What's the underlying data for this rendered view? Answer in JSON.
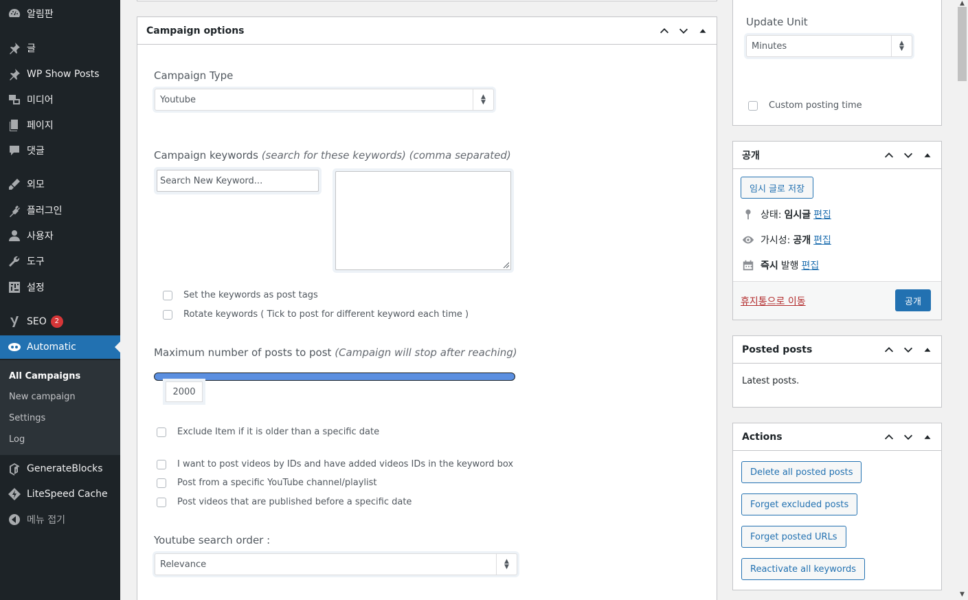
{
  "sidebar": {
    "items": [
      {
        "label": "알림판",
        "icon": "dashboard-icon"
      },
      {
        "label": "글",
        "icon": "pin-icon"
      },
      {
        "label": "WP Show Posts",
        "icon": "pin-icon"
      },
      {
        "label": "미디어",
        "icon": "media-icon"
      },
      {
        "label": "페이지",
        "icon": "page-icon"
      },
      {
        "label": "댓글",
        "icon": "comment-icon"
      },
      {
        "label": "외모",
        "icon": "brush-icon"
      },
      {
        "label": "플러그인",
        "icon": "plugin-icon"
      },
      {
        "label": "사용자",
        "icon": "user-icon"
      },
      {
        "label": "도구",
        "icon": "wrench-icon"
      },
      {
        "label": "설정",
        "icon": "settings-icon"
      },
      {
        "label": "SEO",
        "icon": "yoast-icon",
        "badge": "2"
      },
      {
        "label": "Automatic",
        "icon": "automatic-icon",
        "active": true
      },
      {
        "label": "GenerateBlocks",
        "icon": "generateblocks-icon"
      },
      {
        "label": "LiteSpeed Cache",
        "icon": "litespeed-icon"
      },
      {
        "label": "메뉴 접기",
        "icon": "collapse-icon"
      }
    ],
    "submenu": [
      "All Campaigns",
      "New campaign",
      "Settings",
      "Log"
    ]
  },
  "campaign_options": {
    "title": "Campaign options",
    "campaign_type_label": "Campaign Type",
    "campaign_type_value": "Youtube",
    "keywords_label": "Campaign keywords",
    "keywords_hint": "(search for these keywords) (comma separated)",
    "keyword_search_placeholder": "Search New Keyword...",
    "cb_tags": "Set the keywords as post tags",
    "cb_rotate": "Rotate keywords ( Tick to post for different keyword each time )",
    "max_posts_label": "Maximum number of posts to post",
    "max_posts_hint": "(Campaign will stop after reaching)",
    "max_posts_value": "2000",
    "cb_exclude_old": "Exclude Item if it is older than a specific date",
    "cb_video_ids": "I want to post videos by IDs and have added videos IDs in the keyword box",
    "cb_channel": "Post from a specific YouTube channel/playlist",
    "cb_before_date": "Post videos that are published before a specific date",
    "search_order_label": "Youtube search order :",
    "search_order_value": "Relevance"
  },
  "update_box": {
    "update_unit_label": "Update Unit",
    "update_unit_value": "Minutes",
    "custom_posting_time": "Custom posting time"
  },
  "publish_box": {
    "title": "공개",
    "save_draft": "임시 글로 저장",
    "status_label": "상태:",
    "status_value": "임시글",
    "visibility_label": "가시성:",
    "visibility_value": "공개",
    "publish_time_bold": "즉시",
    "publish_time_label": "발행",
    "edit": "편집",
    "trash": "휴지통으로 이동",
    "publish_button": "공개"
  },
  "posted_posts_box": {
    "title": "Posted posts",
    "text": "Latest posts."
  },
  "actions_box": {
    "title": "Actions",
    "buttons": [
      "Delete all posted posts",
      "Forget excluded posts",
      "Forget posted URLs",
      "Reactivate all keywords"
    ]
  }
}
